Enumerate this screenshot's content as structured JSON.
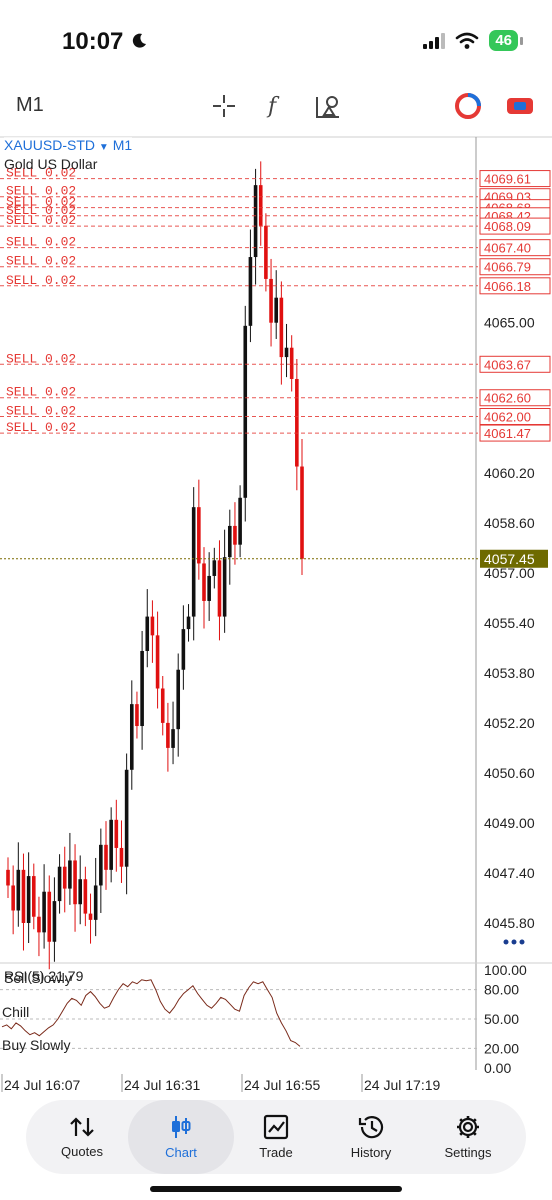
{
  "status": {
    "time": "10:07",
    "battery": "46"
  },
  "toolbar": {
    "timeframe": "M1"
  },
  "symbol": {
    "name": "XAUUSD-STD",
    "timeframe": "M1",
    "description": "Gold US Dollar"
  },
  "price_axis": {
    "ticks": [
      "4065.00",
      "4060.20",
      "4058.60",
      "4057.00",
      "4055.40",
      "4053.80",
      "4052.20",
      "4050.60",
      "4049.00",
      "4047.40",
      "4045.80"
    ],
    "current_price": "4057.45"
  },
  "orders": [
    {
      "label": "SELL 0.02",
      "price": "4069.61"
    },
    {
      "label": "SELL 0.02",
      "price": "4069.03"
    },
    {
      "label": "SELL 0.02",
      "price": "4068.68"
    },
    {
      "label": "SELL 0.02",
      "price": "4068.42"
    },
    {
      "label": "SELL 0.02",
      "price": "4068.09"
    },
    {
      "label": "SELL 0.02",
      "price": "4067.40"
    },
    {
      "label": "SELL 0.02",
      "price": "4066.79"
    },
    {
      "label": "SELL 0.02",
      "price": "4066.18"
    },
    {
      "label": "SELL 0.02",
      "price": "4063.67"
    },
    {
      "label": "SELL 0.02",
      "price": "4062.60"
    },
    {
      "label": "SELL 0.02",
      "price": "4062.00"
    },
    {
      "label": "SELL 0.02",
      "price": "4061.47"
    }
  ],
  "indicator": {
    "title": "RSI(5) 21.79",
    "overlay_label": "Sell Slowly",
    "mid_label": "Chill",
    "low_label": "Buy Slowly",
    "levels": [
      "100.00",
      "80.00",
      "50.00",
      "20.00",
      "0.00"
    ]
  },
  "time_axis": [
    "24 Jul 16:07",
    "24 Jul 16:31",
    "24 Jul 16:55",
    "24 Jul 17:19"
  ],
  "tabs": [
    {
      "label": "Quotes",
      "icon": "quotes-icon"
    },
    {
      "label": "Chart",
      "icon": "chart-icon"
    },
    {
      "label": "Trade",
      "icon": "trade-icon"
    },
    {
      "label": "History",
      "icon": "history-icon"
    },
    {
      "label": "Settings",
      "icon": "settings-icon"
    }
  ],
  "chart_data": {
    "type": "candlestick",
    "symbol": "XAUUSD-STD",
    "timeframe": "M1",
    "x": [
      "24 Jul 16:07",
      "24 Jul 16:31",
      "24 Jul 16:55",
      "24 Jul 17:19"
    ],
    "ylim": [
      4045.0,
      4070.3
    ],
    "closes": [
      4047.0,
      4046.2,
      4047.5,
      4045.8,
      4047.3,
      4046.0,
      4045.5,
      4046.8,
      4045.2,
      4046.5,
      4047.6,
      4046.9,
      4047.8,
      4046.4,
      4047.2,
      4046.1,
      4045.9,
      4047.0,
      4048.3,
      4047.5,
      4049.1,
      4048.2,
      4047.6,
      4050.7,
      4052.8,
      4052.1,
      4054.5,
      4055.6,
      4055.0,
      4053.3,
      4052.2,
      4051.4,
      4052.0,
      4053.9,
      4055.2,
      4055.6,
      4059.1,
      4057.3,
      4056.1,
      4056.9,
      4057.4,
      4055.6,
      4057.5,
      4058.5,
      4057.9,
      4059.4,
      4064.9,
      4067.1,
      4069.4,
      4068.1,
      4066.4,
      4065.0,
      4065.8,
      4063.9,
      4064.2,
      4063.2,
      4060.4,
      4057.45
    ],
    "rsi_levels": [
      100,
      80,
      50,
      20,
      0
    ],
    "rsi_values": [
      42,
      44,
      40,
      46,
      43,
      38,
      34,
      36,
      33,
      37,
      41,
      44,
      50,
      58,
      66,
      71,
      69,
      64,
      74,
      78,
      73,
      66,
      61,
      63,
      72,
      80,
      86,
      83,
      88,
      86,
      90,
      89,
      90,
      80,
      68,
      60,
      56,
      62,
      70,
      76,
      80,
      84,
      76,
      70,
      64,
      61,
      66,
      72,
      70,
      65,
      60,
      58,
      74,
      82,
      88,
      86,
      88,
      80,
      72,
      56,
      46,
      38,
      28,
      26,
      22
    ]
  }
}
